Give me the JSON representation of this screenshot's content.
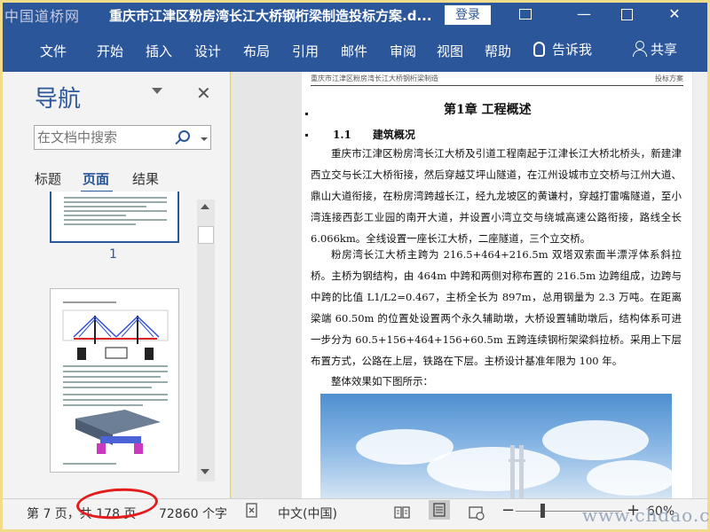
{
  "watermarks": {
    "top": "中国道桥网",
    "bottom": "www.chdao.com"
  },
  "titlebar": {
    "title": "重庆市江津区粉房湾长江大桥钢桁梁制造投标方案.d...",
    "login": "登录",
    "ribbon_options_icon": "ribbon-display-options-icon",
    "minimize": "—",
    "close": "✕"
  },
  "menu": {
    "items": [
      "文件",
      "开始",
      "插入",
      "设计",
      "布局",
      "引用",
      "邮件",
      "审阅",
      "视图",
      "帮助"
    ],
    "tell_me": "告诉我",
    "share": "共享"
  },
  "nav": {
    "title": "导航",
    "close": "✕",
    "search_placeholder": "在文档中搜索",
    "tabs": {
      "headings": "标题",
      "pages": "页面",
      "results": "结果"
    },
    "active_tab": "pages",
    "thumb_page_number": "1"
  },
  "document": {
    "running_head": "重庆市江津区粉房湾长江大桥钢桁梁制造",
    "running_head_right": "投标方案",
    "chapter_title": "第1章 工程概述",
    "section_title": "1.1　　建筑概况",
    "paragraphs": [
      "重庆市江津区粉房湾长江大桥及引道工程南起于江津长江大桥北桥头，新建津西立交与长江大桥衔接，然后穿越艾坪山隧道，在江州设城市立交桥与江州大道、鼎山大道衔接，在粉房湾跨越长江，经九龙坡区的黄谦村，穿越打雷嘴隧道，至小湾连接西彭工业园的南开大道，并设置小湾立交与绕城高速公路衔接，路线全长 6.066km。全线设置一座长江大桥，二座隧道，三个立交桥。",
      "粉房湾长江大桥主跨为 216.5+464+216.5m 双塔双索面半漂浮体系斜拉桥。主桥为钢结构，由 464m 中跨和两侧对称布置的 216.5m 边跨组成，边跨与中跨的比值 L1/L2=0.467，主桥全长为 897m，总用钢量为 2.3 万吨。在距离梁端 60.50m 的位置处设置两个永久辅助墩，大桥设置辅助墩后，结构体系可进一步分为 60.5+156+464+156+60.5m 五跨连续钢桁架梁斜拉桥。采用上下层布置方式，公路在上层，铁路在下层。主桥设计基准年限为 100 年。",
      "整体效果如下图所示："
    ]
  },
  "status": {
    "page": "第 7 页，共 178 页",
    "words": "72860 个字",
    "language": "中文(中国)",
    "zoom_minus": "−",
    "zoom_plus": "+",
    "zoom": "60%",
    "zoom_level_percent": 60
  },
  "colors": {
    "accent": "#2b579a",
    "annotation": "#e31c1c"
  }
}
